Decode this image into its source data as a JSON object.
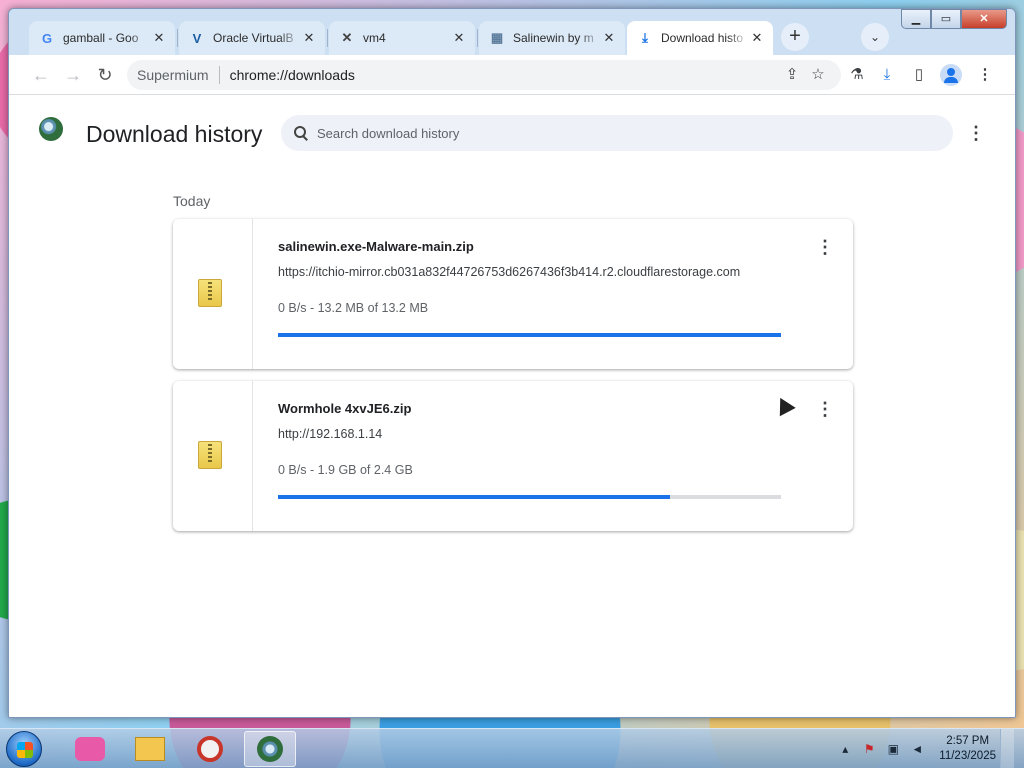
{
  "window": {
    "tabs": [
      {
        "title": "gamball - Goo",
        "icon": "google-icon",
        "close": "✕"
      },
      {
        "title": "Oracle VirtualB",
        "icon": "virtualbox-icon",
        "close": "✕"
      },
      {
        "title": "vm4",
        "icon": "vm4-icon",
        "close": "✕"
      },
      {
        "title": "Salinewin by m",
        "icon": "itchio-icon",
        "close": "✕"
      },
      {
        "title": "Download histo",
        "icon": "download-icon",
        "close": "✕",
        "active": true
      }
    ],
    "new_tab": "+",
    "tab_search": "⌄",
    "caption": {
      "minimize": "▁",
      "maximize": "▭",
      "close": "✕"
    }
  },
  "toolbar": {
    "back": "←",
    "forward": "→",
    "reload": "↻",
    "omnibox_label": "Supermium",
    "url": "chrome://downloads",
    "share_icon": "⇪",
    "bookmark_icon": "☆",
    "extensions_icon": "⚗",
    "downloads_icon": "⤓",
    "sidepanel_icon": "▯",
    "menu_icon": "⋮"
  },
  "page": {
    "title": "Download history",
    "search_placeholder": "Search download history",
    "menu_icon": "⋮",
    "section": "Today",
    "downloads": [
      {
        "filename": "salinewin.exe-Malware-main.zip",
        "url": "https://itchio-mirror.cb031a832f44726753d6267436f3b414.r2.cloudflarestorage.com",
        "status": "0 B/s - 13.2 MB of 13.2 MB",
        "progress": 1.0,
        "icon": "zip-folder-icon",
        "menu": "⋮"
      },
      {
        "filename": "Wormhole 4xvJE6.zip",
        "url": "http://192.168.1.14",
        "status": "0 B/s - 1.9 GB of 2.4 GB",
        "progress": 0.78,
        "icon": "zip-folder-icon",
        "menu": "⋮"
      }
    ],
    "accent_color": "#1a73e8"
  },
  "taskbar": {
    "apps": [
      "catgirl-app-icon",
      "file-explorer-icon",
      "opera-icon",
      "supermium-icon"
    ],
    "tray_arrow": "▴",
    "time": "2:57 PM",
    "date": "11/23/2025"
  }
}
